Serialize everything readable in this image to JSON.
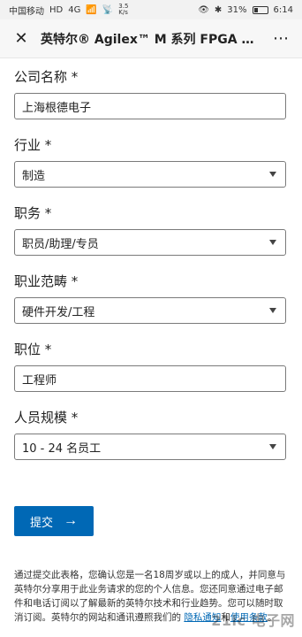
{
  "status_bar": {
    "carrier": "中国移动",
    "hd": "HD",
    "net": "4G",
    "speed_top": "3.5",
    "speed_bottom": "K/s",
    "battery": "31%",
    "time": "6:14"
  },
  "app_bar": {
    "title": "英特尔® Agilex™ M 系列 FPGA 打…"
  },
  "form": {
    "company": {
      "label": "公司名称 *",
      "value": "上海根德电子"
    },
    "industry": {
      "label": "行业 *",
      "value": "制造"
    },
    "job_title": {
      "label": "职务 *",
      "value": "职员/助理/专员"
    },
    "job_function": {
      "label": "职业范畴 *",
      "value": "硬件开发/工程"
    },
    "position": {
      "label": "职位 *",
      "value": "工程师"
    },
    "company_size": {
      "label": "人员规模 *",
      "value": "10 - 24 名员工"
    },
    "submit": {
      "label": "提交",
      "arrow": "→"
    }
  },
  "consent": {
    "text_main": "通过提交此表格，您确认您是一名18周岁或以上的成人，并同意与英特尔分享用于此业务请求的您的个人信息。您还同意通过电子邮件和电话订阅以了解最新的英特尔技术和行业趋势。您可以随时取消订阅。英特尔的网站和通讯遵照我们的",
    "privacy_link": "隐私通知",
    "and": "和",
    "terms_link": "使用条款",
    "period": "。"
  },
  "watermark": "21ic 电子网"
}
